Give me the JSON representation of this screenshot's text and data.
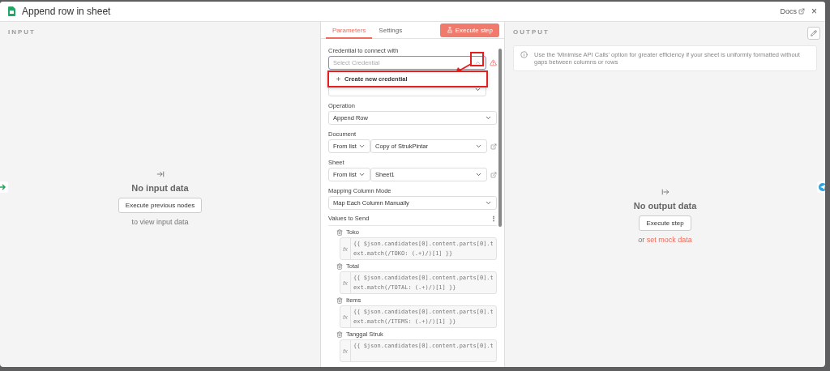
{
  "window": {
    "title": "Append row in sheet",
    "docs_link": "Docs",
    "close": "×"
  },
  "input_panel": {
    "heading": "INPUT",
    "empty_title": "No input data",
    "button": "Execute previous nodes",
    "hint": "to view input data"
  },
  "tabs": [
    {
      "label": "Parameters",
      "selected": true
    },
    {
      "label": "Settings",
      "selected": false
    }
  ],
  "execute_button": "Execute step",
  "credential": {
    "label": "Credential to connect with",
    "placeholder": "Select Credential",
    "menu_item": "Create new credential",
    "warning": true
  },
  "fields": [
    {
      "kind": "select",
      "label": "Operation",
      "value": "Append Row"
    },
    {
      "kind": "pair",
      "label": "Document",
      "mode": "From list",
      "value": "Copy of StrukPintar"
    },
    {
      "kind": "pair",
      "label": "Sheet",
      "mode": "From list",
      "value": "Sheet1"
    },
    {
      "kind": "select",
      "label": "Mapping Column Mode",
      "value": "Map Each Column Manually"
    }
  ],
  "values_to_send": {
    "label": "Values to Send",
    "menu": "⋮",
    "items": [
      {
        "name": "Toko",
        "tag": "fx",
        "lines": [
          "{{ $json.candidates[0].content.parts[0].t",
          "ext.match(/TOKO: (.+)/)[1] }}"
        ]
      },
      {
        "name": "Total",
        "tag": "fx",
        "lines": [
          "{{ $json.candidates[0].content.parts[0].t",
          "ext.match(/TOTAL: (.+)/)[1] }}"
        ]
      },
      {
        "name": "Items",
        "tag": "fx",
        "lines": [
          "{{ $json.candidates[0].content.parts[0].t",
          "ext.match(/ITEMS: (.+)/)[1] }}"
        ]
      },
      {
        "name": "Tanggal Struk",
        "tag": "fx",
        "lines": [
          "{{ $json.candidates[0].content.parts[0].t"
        ]
      }
    ]
  },
  "output_panel": {
    "heading": "OUTPUT",
    "notice": "Use the 'Minimise API Calls' option for greater efficiency if your sheet is uniformly formatted without gaps between columns or rows",
    "empty_title": "No output data",
    "button": "Execute step",
    "hint_prefix": "or",
    "hint_link": "set mock data"
  }
}
